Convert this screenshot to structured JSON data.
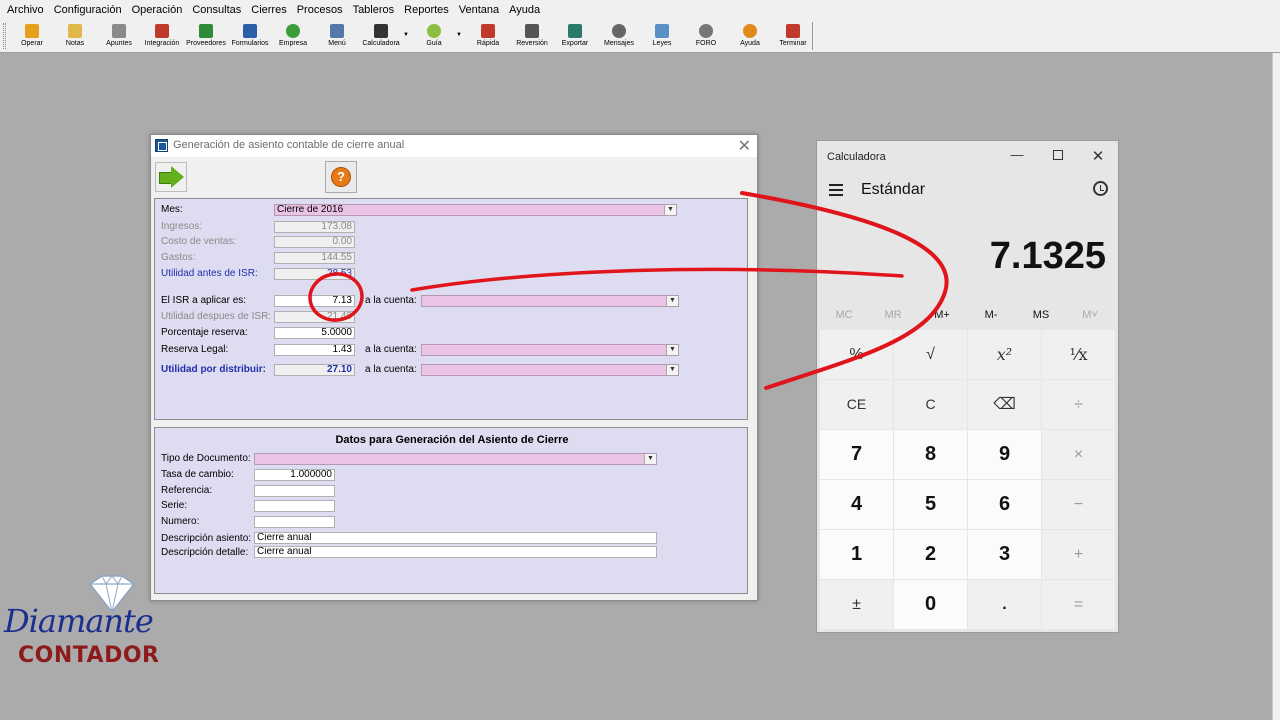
{
  "menu": [
    "Archivo",
    "Configuración",
    "Operación",
    "Consultas",
    "Cierres",
    "Procesos",
    "Tableros",
    "Reportes",
    "Ventana",
    "Ayuda"
  ],
  "toolbar": [
    {
      "label": "Operar",
      "icon": "lightning-icon",
      "color": "#e5a01a"
    },
    {
      "label": "Notas",
      "icon": "notes-icon",
      "color": "#e0b84a"
    },
    {
      "label": "Apuntes",
      "icon": "notebook-icon",
      "color": "#8a8a8a"
    },
    {
      "label": "Integración",
      "icon": "integration-icon",
      "color": "#c0392b"
    },
    {
      "label": "Proveedores",
      "icon": "suppliers-icon",
      "color": "#2e8b3a"
    },
    {
      "label": "Formularios",
      "icon": "forms-icon",
      "color": "#2c5fa8"
    },
    {
      "label": "Empresa",
      "icon": "refresh-icon",
      "color": "#3a9d3a"
    },
    {
      "label": "Menú",
      "icon": "menu-icon",
      "color": "#5577aa"
    },
    {
      "label": "Calculadora",
      "icon": "calculator-icon",
      "color": "#333333"
    },
    {
      "label": "Guía",
      "icon": "guide-icon",
      "color": "#8cbf3f"
    },
    {
      "label": "Rápida",
      "icon": "rocket-icon",
      "color": "#c0392b"
    },
    {
      "label": "Reversión",
      "icon": "binoculars-icon",
      "color": "#555555"
    },
    {
      "label": "Exportar",
      "icon": "export-icon",
      "color": "#2a7a6a"
    },
    {
      "label": "Mensajes",
      "icon": "messages-icon",
      "color": "#666666"
    },
    {
      "label": "Leyes",
      "icon": "laws-icon",
      "color": "#5b8fc7"
    },
    {
      "label": "FORO",
      "icon": "forum-icon",
      "color": "#777777"
    },
    {
      "label": "Ayuda",
      "icon": "help-icon",
      "color": "#e08a1e"
    },
    {
      "label": "Terminar",
      "icon": "exit-icon",
      "color": "#c0392b"
    }
  ],
  "dialog": {
    "title": "Generación de asiento contable de cierre anual",
    "help_glyph": "?",
    "mes_label": "Mes:",
    "mes_value": "Cierre de 2016",
    "ingresos_label": "Ingresos:",
    "ingresos_value": "173.08",
    "costo_label": "Costo de ventas:",
    "costo_value": "0.00",
    "gastos_label": "Gastos:",
    "gastos_value": "144.55",
    "utilidad_antes_label": "Utilidad antes de ISR:",
    "utilidad_antes_value": "28.53",
    "isr_label": "El ISR a aplicar es:",
    "isr_value": "7.13",
    "a_la_cuenta": "a la cuenta:",
    "utilidad_despues_label": "Utilidad despues de ISR:",
    "utilidad_despues_value": "21.40",
    "porcentaje_label": "Porcentaje reserva:",
    "porcentaje_value": "5.0000",
    "reserva_label": "Reserva Legal:",
    "reserva_value": "1.43",
    "utilidad_dist_label": "Utilidad por distribuir:",
    "utilidad_dist_value": "27.10",
    "datos_title": "Datos para Generación del Asiento de Cierre",
    "tipo_doc_label": "Tipo de Documento:",
    "tasa_label": "Tasa de cambio:",
    "tasa_value": "1.000000",
    "referencia_label": "Referencia:",
    "serie_label": "Serie:",
    "numero_label": "Numero:",
    "desc_asiento_label": "Descripción asiento:",
    "desc_asiento_value": "Cierre anual",
    "desc_detalle_label": "Descripción detalle:",
    "desc_detalle_value": "Cierre anual"
  },
  "calculator": {
    "title": "Calculadora",
    "mode": "Estándar",
    "display": "7.1325",
    "memory": [
      "MC",
      "MR",
      "M+",
      "M-",
      "MS",
      "M˅"
    ],
    "keys": [
      "%",
      "√",
      "x²",
      "¹⁄x",
      "CE",
      "C",
      "⌫",
      "÷",
      "7",
      "8",
      "9",
      "×",
      "4",
      "5",
      "6",
      "−",
      "1",
      "2",
      "3",
      "+",
      "±",
      "0",
      ".",
      "="
    ]
  },
  "logo": {
    "script": "Diamante",
    "word": "CONTADOR"
  },
  "colors": {
    "annotation": "#e0141b",
    "field_pink": "#ebc3e5",
    "panel_lavender": "#dedcf0",
    "label_blue": "#1f2fae"
  }
}
